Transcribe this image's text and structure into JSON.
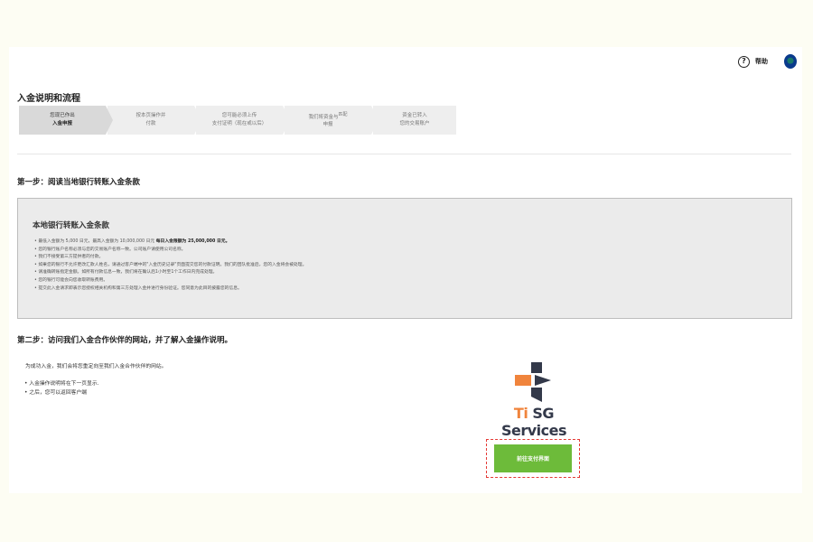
{
  "header": {
    "help_icon_glyph": "?",
    "help_label": "帮助"
  },
  "page": {
    "title": "入金说明和流程"
  },
  "steps": [
    {
      "line1": "您现已作出",
      "line2": "入金申报"
    },
    {
      "line1": "按本页操作并",
      "line2": "付款"
    },
    {
      "line1": "您可能必须上传",
      "line2": "支付证明（现在或以后）"
    },
    {
      "line1": "我们将资金与",
      "line1_small": "匹配",
      "line2": "申报"
    },
    {
      "line1": "资金已转入",
      "line2": "您的交易账户"
    }
  ],
  "step1": {
    "heading": "第一步：阅读当地银行转账入金条款",
    "box_title": "本地银行转账入金条款",
    "terms": {
      "t1_pre": "最低入金额为 5,000 日元，最高入金额为 10,000,000 日元 ",
      "t1_bold": "每日入金限额为 25,000,000 日元。",
      "t2": "您的银行账户名称必须与您的交易账户名称一致。公司账户请使用公司名称。",
      "t3": "我们不接受第三方提供者的付款。",
      "t4": "如果您的银行不允许更改汇款人姓名，请通过客户端中的\"入金历史记录\"页面提交您的付款证明。我们的团队批准后，您的入金将会被处理。",
      "t5": "请准确转账指定金额。如所有付款信息一致，我们将在确认后1小时至1个工作日内完成处理。",
      "t6": "您的银行可能会向您收取转账费用。",
      "t7": "提交此入金请求即表示您授权相关机构和第三方处理入金并进行身份验证。您同意为此目的披露您的信息。"
    }
  },
  "step2": {
    "heading": "第二步：访问我们入金合作伙伴的网站，并了解入金操作说明。",
    "intro": "为成功入金，我们会将您重定向至我们入金合作伙伴的网站。",
    "bullets": [
      "入金操作说明将在下一页显示.",
      "之后，您可以返回客户端"
    ],
    "partner": {
      "brand_accent": "Ti",
      "brand_rest": " SG Services",
      "logo_colors": {
        "orange": "#f0843c",
        "dark": "#33394a"
      }
    },
    "pay_button": "前往支付界面"
  },
  "colors": {
    "accent_green": "#6dbb3a",
    "highlight_red": "#e53935"
  }
}
